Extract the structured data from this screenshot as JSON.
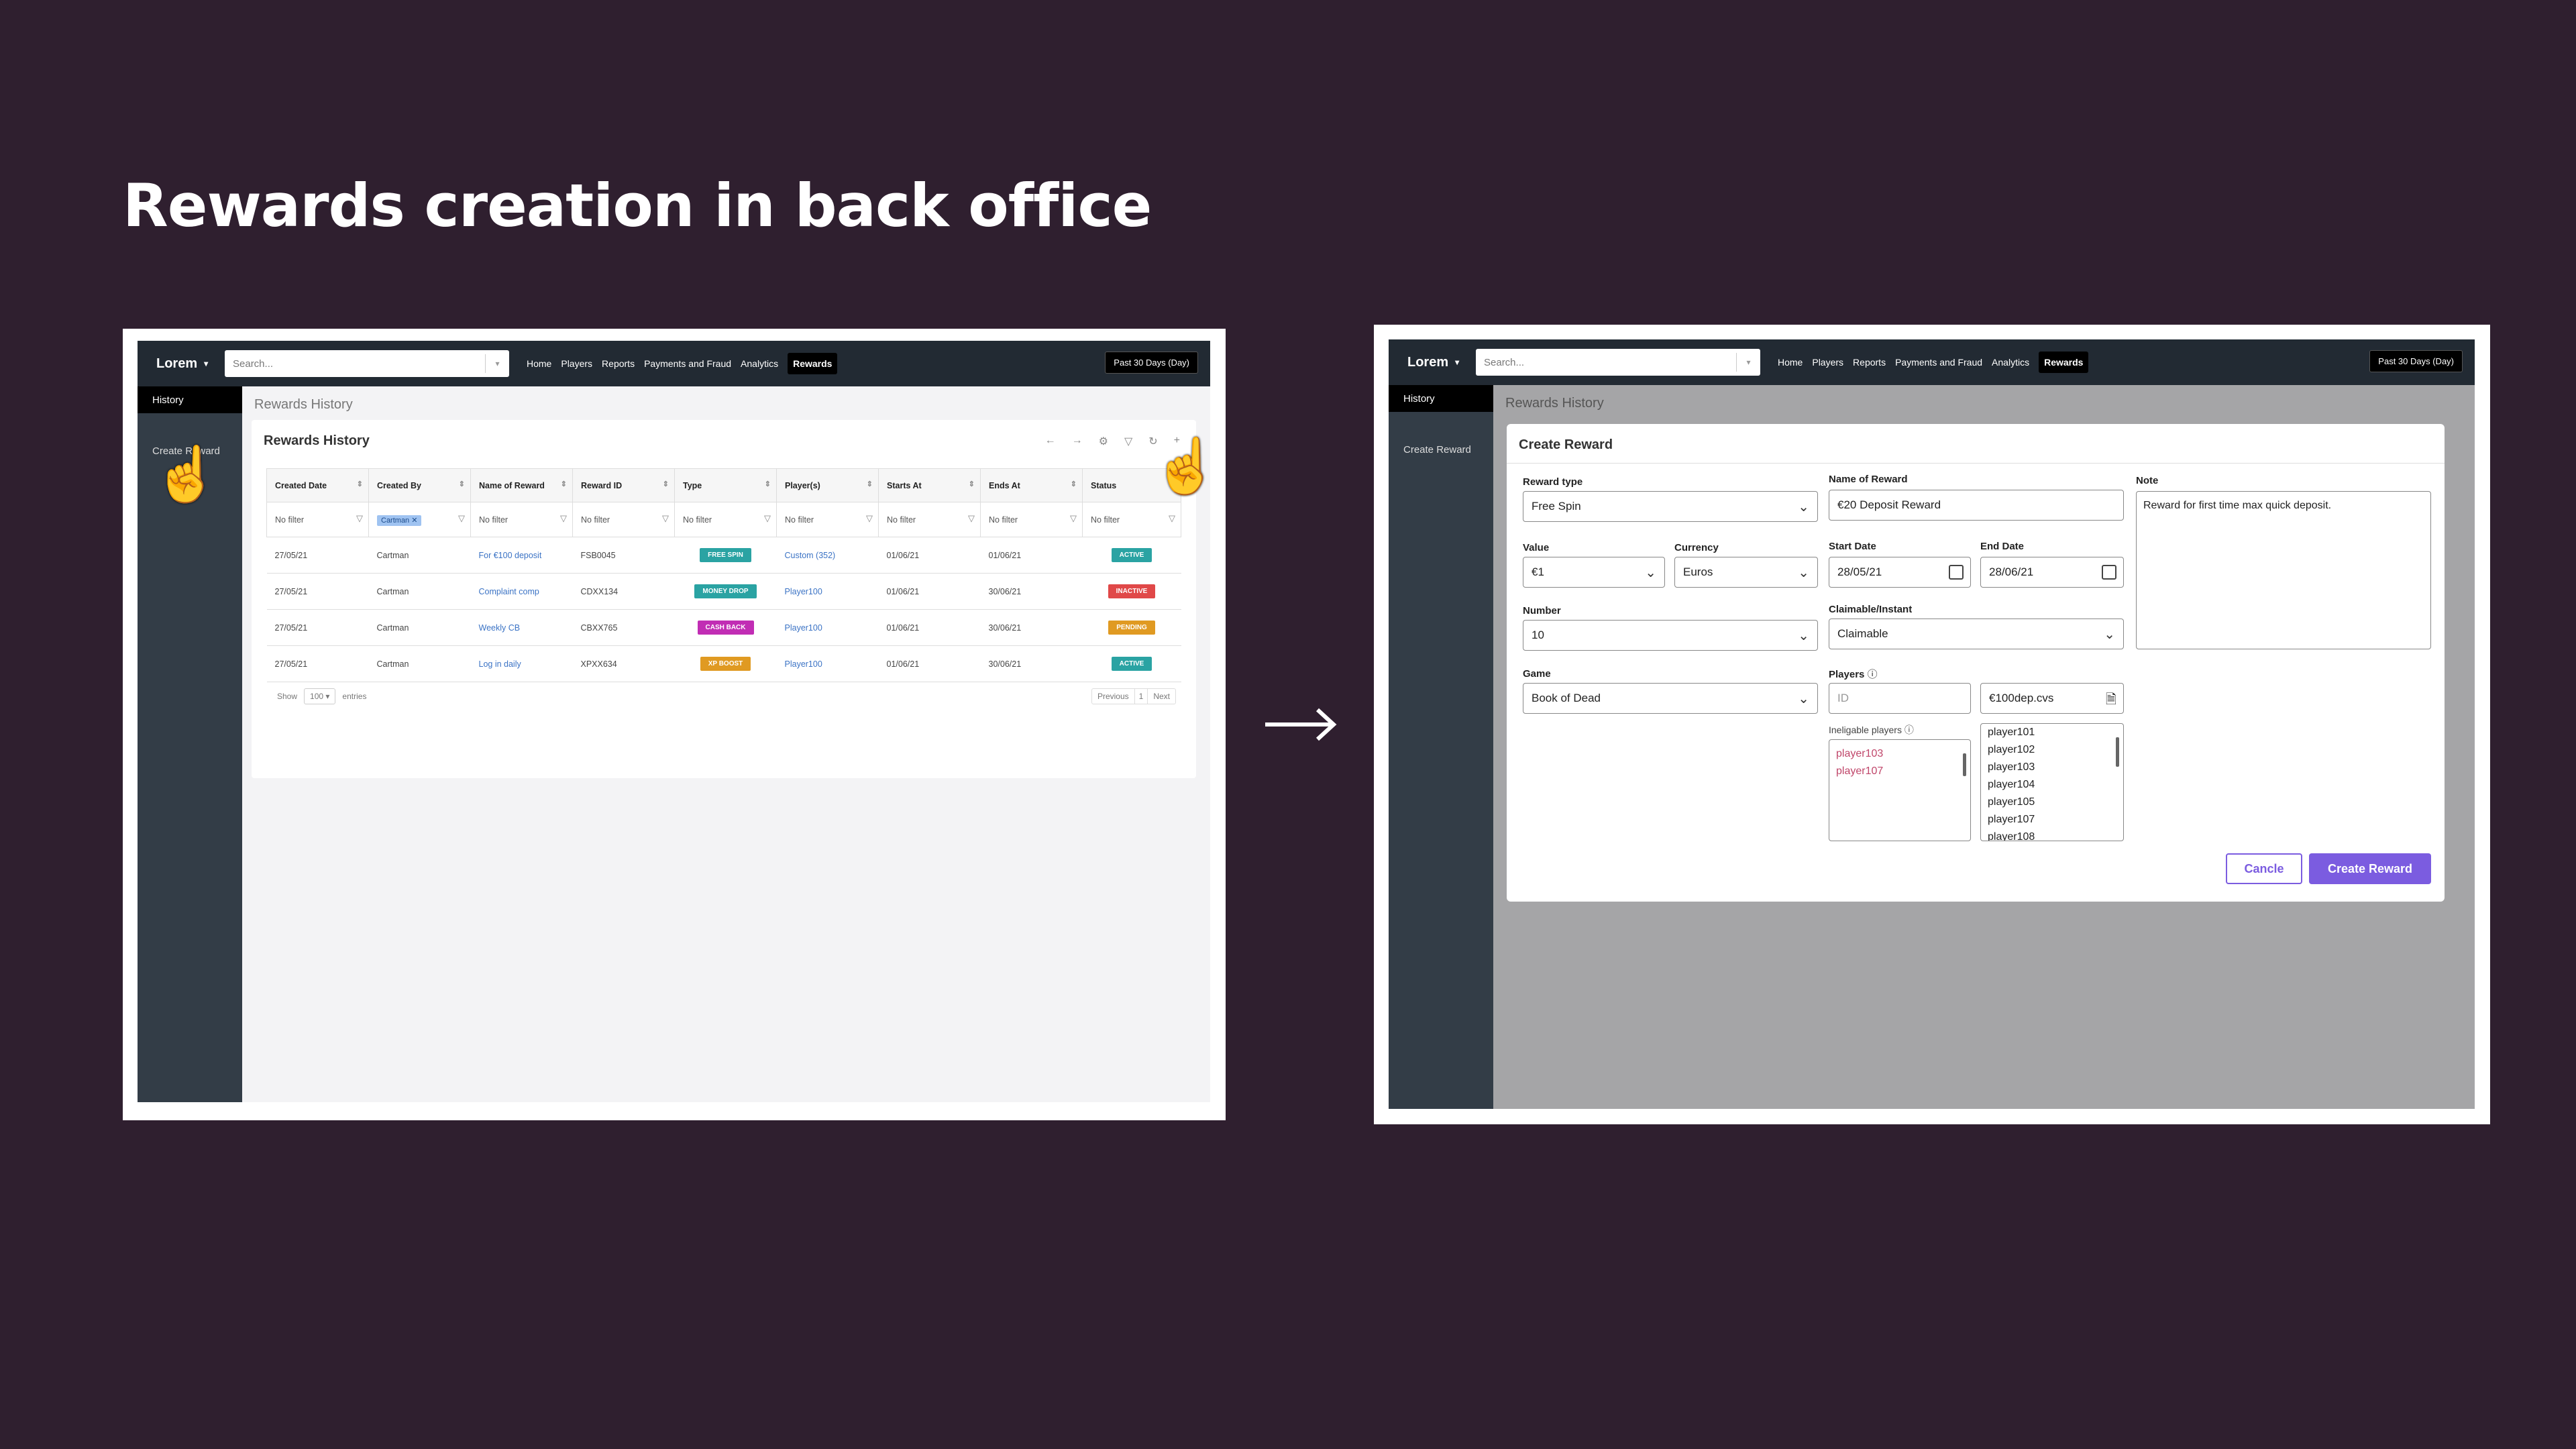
{
  "slide": {
    "title": "Rewards creation in back office"
  },
  "topbar": {
    "logo": "Lorem",
    "search_placeholder": "Search...",
    "nav": [
      "Home",
      "Players",
      "Reports",
      "Payments and Fraud",
      "Analytics",
      "Rewards"
    ],
    "range": "Past 30 Days (Day)"
  },
  "sidebar": {
    "history": "History",
    "create_reward": "Create Reward"
  },
  "breadcrumb": "Rewards History",
  "left": {
    "card_title": "Rewards  History",
    "columns": [
      "Created Date",
      "Created By",
      "Name of Reward",
      "Reward ID",
      "Type",
      "Player(s)",
      "Starts At",
      "Ends At",
      "Status"
    ],
    "filter_placeholder": "No filter",
    "filter_chip": "Cartman",
    "rows": [
      {
        "created": "27/05/21",
        "by": "Cartman",
        "name": "For €100 deposit",
        "id": "FSB0045",
        "type": "FREE SPIN",
        "type_color": "#2aa3a3",
        "players": "Custom (352)",
        "starts": "01/06/21",
        "ends": "01/06/21",
        "status": "ACTIVE",
        "status_color": "#2aa3a3"
      },
      {
        "created": "27/05/21",
        "by": "Cartman",
        "name": "Complaint comp",
        "id": "CDXX134",
        "type": "MONEY DROP",
        "type_color": "#2aa3a3",
        "players": "Player100",
        "starts": "01/06/21",
        "ends": "30/06/21",
        "status": "INACTIVE",
        "status_color": "#e04848"
      },
      {
        "created": "27/05/21",
        "by": "Cartman",
        "name": "Weekly CB",
        "id": "CBXX765",
        "type": "CASH BACK",
        "type_color": "#c12db4",
        "players": "Player100",
        "starts": "01/06/21",
        "ends": "30/06/21",
        "status": "PENDING",
        "status_color": "#e09a22"
      },
      {
        "created": "27/05/21",
        "by": "Cartman",
        "name": "Log in daily",
        "id": "XPXX634",
        "type": "XP BOOST",
        "type_color": "#e09a22",
        "players": "Player100",
        "starts": "01/06/21",
        "ends": "30/06/21",
        "status": "ACTIVE",
        "status_color": "#2aa3a3"
      }
    ],
    "show": "Show",
    "show_value": "100",
    "entries": "entries",
    "previous": "Previous",
    "page": "1",
    "next": "Next"
  },
  "modal": {
    "title": "Create Reward",
    "reward_type_label": "Reward type",
    "reward_type": "Free Spin",
    "name_label": "Name of Reward",
    "name": "€20 Deposit Reward",
    "note_label": "Note",
    "note": "Reward for first time max quick deposit.",
    "value_label": "Value",
    "value": "€1",
    "currency_label": "Currency",
    "currency": "Euros",
    "start_label": "Start Date",
    "start": "28/05/21",
    "end_label": "End Date",
    "end": "28/06/21",
    "number_label": "Number",
    "number": "10",
    "claim_label": "Claimable/Instant",
    "claim": "Claimable",
    "game_label": "Game",
    "game": "Book of Dead",
    "players_label": "Players",
    "id_placeholder": "ID",
    "file": "€100dep.cvs",
    "inelig_label": "Ineligable players",
    "inelig": [
      "player103",
      "player107"
    ],
    "players": [
      "player101",
      "player102",
      "player103",
      "player104",
      "player105",
      "player107",
      "player108"
    ],
    "cancel": "Cancle",
    "create": "Create Reward"
  },
  "colors": {
    "bg": "#2f1f2f",
    "primary": "#7b5ce0",
    "topbar": "#222a33",
    "sidebar": "#333d47"
  }
}
